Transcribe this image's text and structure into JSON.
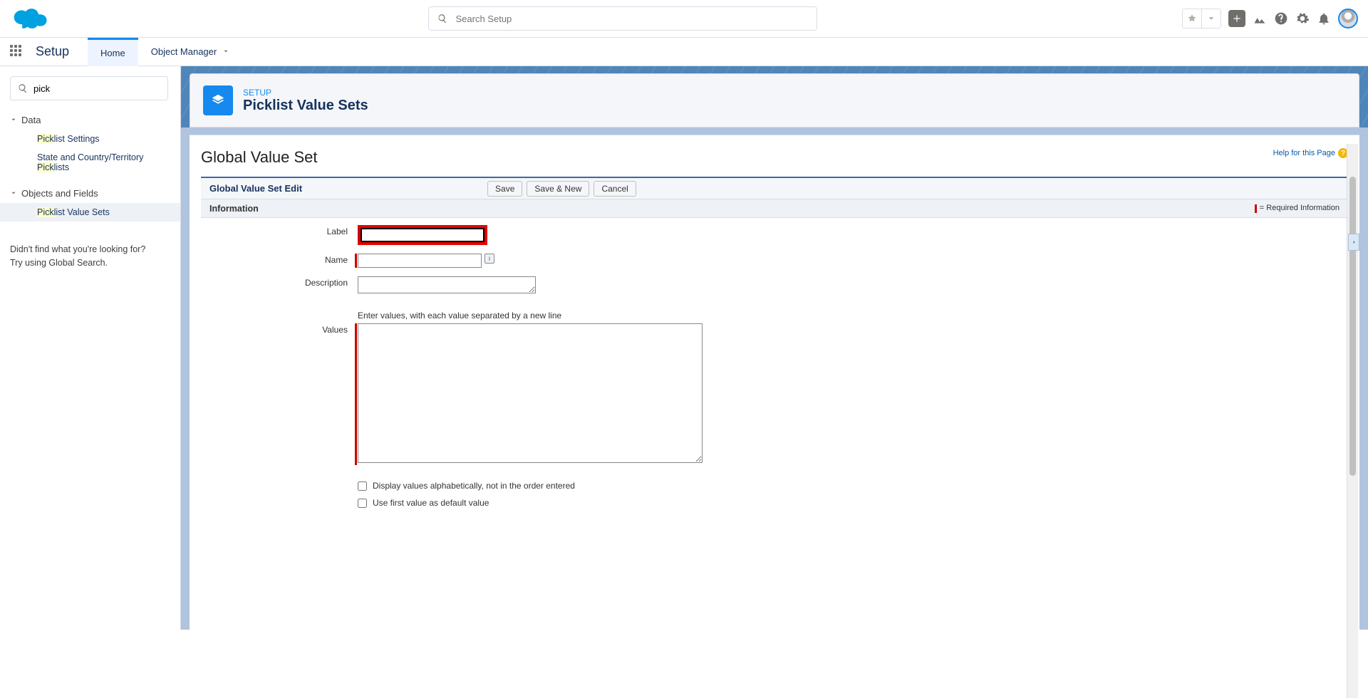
{
  "header": {
    "searchPlaceholder": "Search Setup"
  },
  "nav": {
    "appTitle": "Setup",
    "homeTab": "Home",
    "objectManagerTab": "Object Manager"
  },
  "sidebar": {
    "searchValue": "pick",
    "sections": {
      "data": {
        "label": "Data",
        "items": [
          {
            "prefix": "Pick",
            "rest": "list Settings"
          },
          {
            "full": "State and Country/Territory"
          },
          {
            "prefix": "Pick",
            "rest": "lists"
          }
        ]
      },
      "objects": {
        "label": "Objects and Fields",
        "items": [
          {
            "prefix": "Pick",
            "rest": "list Value Sets",
            "active": true
          }
        ]
      }
    },
    "hintLine1": "Didn't find what you're looking for?",
    "hintLine2": "Try using Global Search."
  },
  "page": {
    "kicker": "SETUP",
    "title": "Picklist Value Sets",
    "cardTitle": "Global Value Set",
    "helpText": "Help for this Page",
    "editHeader": "Global Value Set Edit",
    "buttons": {
      "save": "Save",
      "saveNew": "Save & New",
      "cancel": "Cancel"
    },
    "sectionInfo": "Information",
    "requiredNote": "= Required Information",
    "form": {
      "labelLabel": "Label",
      "nameLabel": "Name",
      "descLabel": "Description",
      "valuesLabel": "Values",
      "valuesHint": "Enter values, with each value separated by a new line",
      "ckAlpha": "Display values alphabetically, not in the order entered",
      "ckDefault": "Use first value as default value",
      "labelValue": "",
      "nameValue": "",
      "descValue": "",
      "valuesValue": ""
    }
  }
}
